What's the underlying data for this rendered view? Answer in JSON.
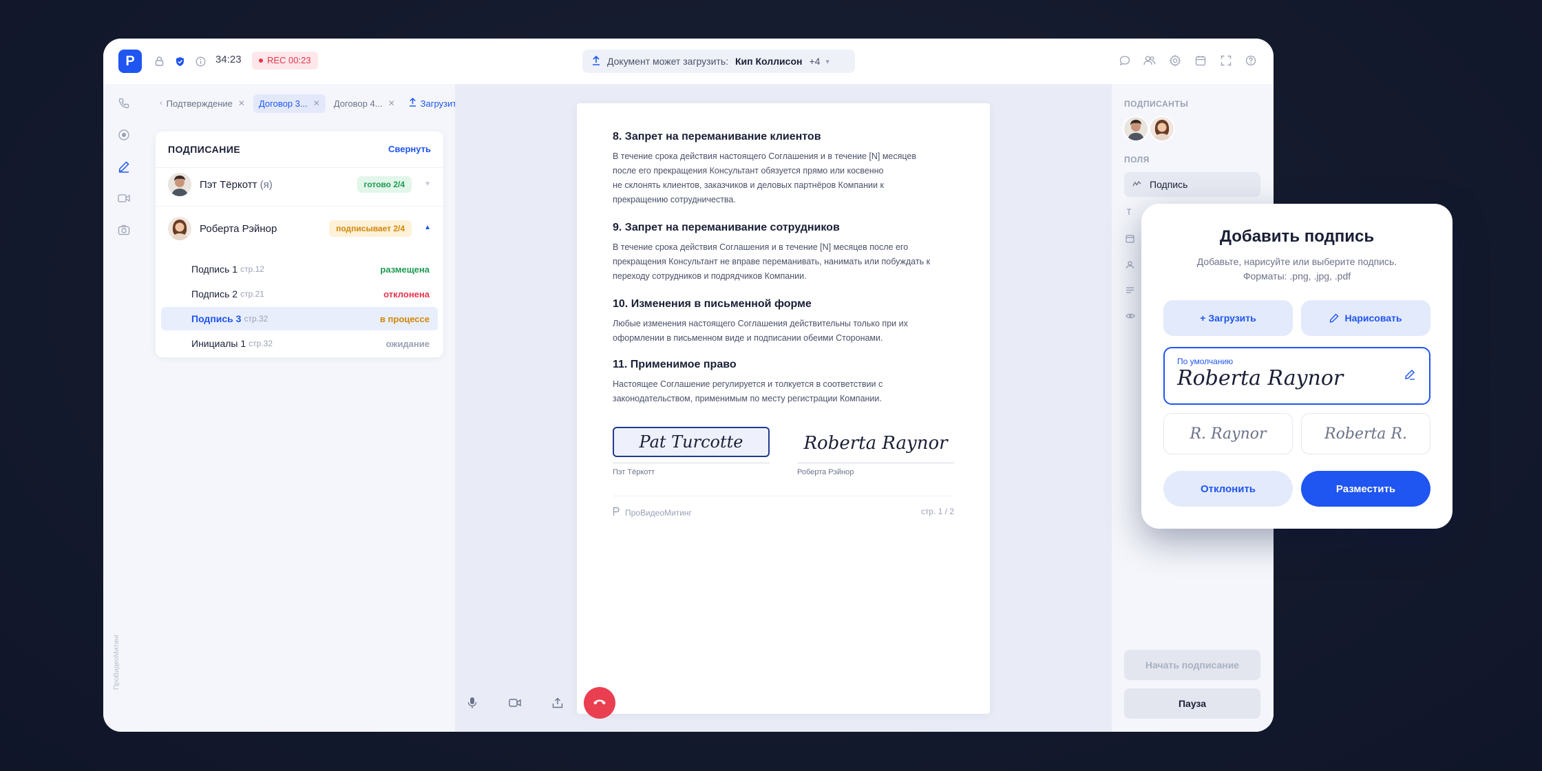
{
  "app": {
    "logo_letter": "Р",
    "timer": "34:23",
    "rec_label": "REC 00:23",
    "upload_pill": {
      "label": "Документ может загрузить:",
      "name": "Кип Коллисон",
      "extra": "+4"
    },
    "rail_brand": "ПроВидеоМитинг"
  },
  "tabs": [
    {
      "label": "Подтверждение",
      "active": false
    },
    {
      "label": "Договор 3...",
      "active": true
    },
    {
      "label": "Договор 4...",
      "active": false
    },
    {
      "label": "Загрузить",
      "upload": true
    }
  ],
  "signing": {
    "heading": "ПОДПИСАНИЕ",
    "collapse_label": "Свернуть",
    "signers": [
      {
        "name": "Пэт Тёркотт",
        "suffix": "(я)",
        "status": "готово 2/4",
        "status_color": "green"
      },
      {
        "name": "Роберта Рэйнор",
        "suffix": "",
        "status": "подписывает 2/4",
        "status_color": "orange"
      }
    ],
    "fields": [
      {
        "label": "Подпись 1",
        "page": "стр.12",
        "status": "размещена",
        "status_color": "#1d9a52"
      },
      {
        "label": "Подпись 2",
        "page": "стр.21",
        "status": "отклонена",
        "status_color": "#e5354c"
      },
      {
        "label": "Подпись 3",
        "page": "стр.32",
        "status": "в процессе",
        "status_color": "#d28708"
      },
      {
        "label": "Инициалы 1",
        "page": "стр.32",
        "status": "ожидание",
        "status_color": "#9aa1b5"
      }
    ]
  },
  "document": {
    "sections": [
      {
        "title": "8. Запрет на переманивание клиентов",
        "lines": [
          "В течение срока действия настоящего Соглашения и в течение [N] месяцев",
          "после его прекращения Консультант обязуется прямо или косвенно",
          "не склонять клиентов, заказчиков и деловых партнёров Компании к",
          "прекращению сотрудничества."
        ]
      },
      {
        "title": "9. Запрет на переманивание сотрудников",
        "lines": [
          "В течение срока действия Соглашения и в течение [N] месяцев после его",
          "прекращения Консультант не вправе переманивать, нанимать или побуждать к",
          "переходу сотрудников и подрядчиков Компании."
        ]
      },
      {
        "title": "10. Изменения в письменной форме",
        "lines": [
          "Любые изменения настоящего Соглашения действительны только при их",
          "оформлении в письменном виде и подписании обеими Сторонами."
        ]
      },
      {
        "title": "11. Применимое право",
        "lines": [
          "Настоящее Соглашение регулируется и толкуется в соответствии с",
          "законодательством, применимым по месту регистрации Компании."
        ]
      }
    ],
    "signature_left": {
      "script": "Pat Turcotte",
      "caption": "Пэт Тёркотт"
    },
    "signature_right": {
      "script": "Roberta Raynor",
      "caption": "Роберта Рэйнор"
    },
    "brand": "ПроВидеоМитинг",
    "page": "стр. 1 / 2"
  },
  "right_panel": {
    "signers_label": "ПОДПИСАНТЫ",
    "fields_label": "ПОЛЯ",
    "field_active": "Подпись",
    "start_button": "Начать подписание",
    "pause_button": "Пауза"
  },
  "modal": {
    "title": "Добавить подпись",
    "subtitle_line1": "Добавьте, нарисуйте или выберите подпись.",
    "subtitle_line2": "Форматы: .png, .jpg, .pdf",
    "upload_button": "+ Загрузить",
    "draw_button": "Нарисовать",
    "default_label": "По умолчанию",
    "default_signature": "Roberta Raynor",
    "alt_signatures": [
      "R. Raynor",
      "Roberta R."
    ],
    "decline_button": "Отклонить",
    "place_button": "Разместить"
  },
  "colors": {
    "accent": "#1f55f0",
    "rec": "#e5354c",
    "endcall": "#ea3f51",
    "ok": "#1d9a52",
    "warn": "#d28708"
  }
}
